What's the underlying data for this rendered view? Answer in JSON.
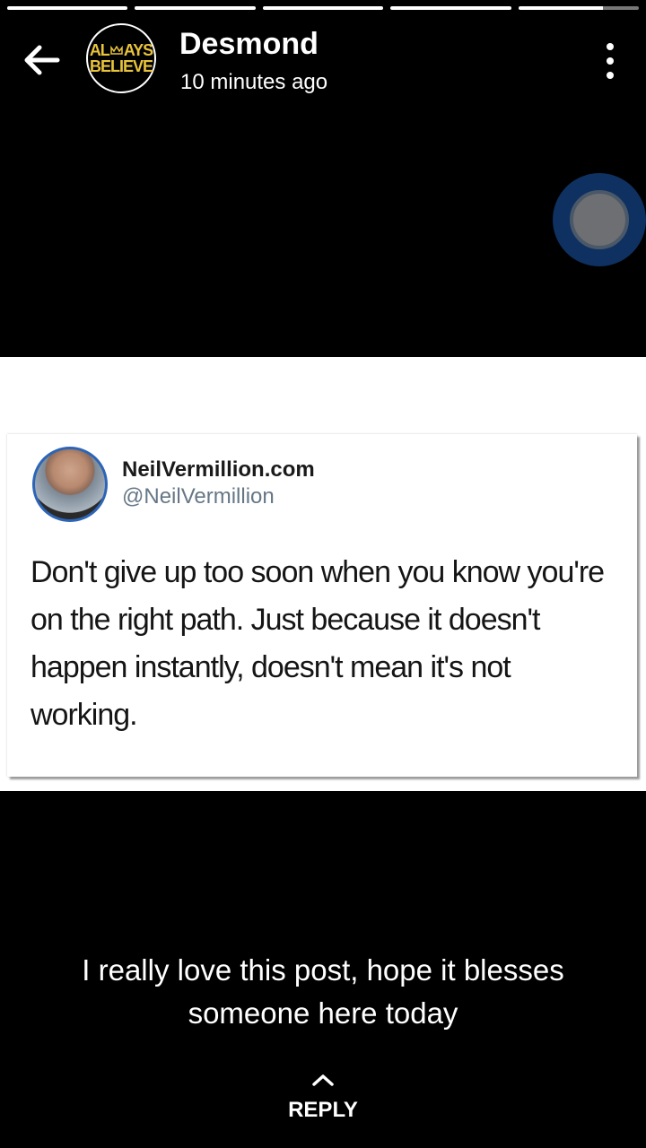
{
  "story": {
    "segments": 5,
    "author_name": "Desmond",
    "timestamp": "10 minutes ago",
    "logo_text_line1_a": "AL",
    "logo_text_line1_b": "AYS",
    "logo_text_line2": "BELIEVE"
  },
  "tweet": {
    "display_name": "NeilVermillion.com",
    "handle": "@NeilVermillion",
    "text": "Don't give up too soon when you know you're on the right path. Just because it doesn't happen instantly, doesn't mean it's not working."
  },
  "caption": "I really love this post,  hope it blesses someone  here today",
  "reply": {
    "label": "REPLY"
  },
  "colors": {
    "logo_gold": "#e9c33b",
    "fab_ring": "#0f3161",
    "avatar_ring": "#2d65b6",
    "handle_gray": "#657786"
  },
  "icons": {
    "back": "arrow-left-icon",
    "menu": "more-vertical-icon",
    "reply": "chevron-up-icon"
  }
}
